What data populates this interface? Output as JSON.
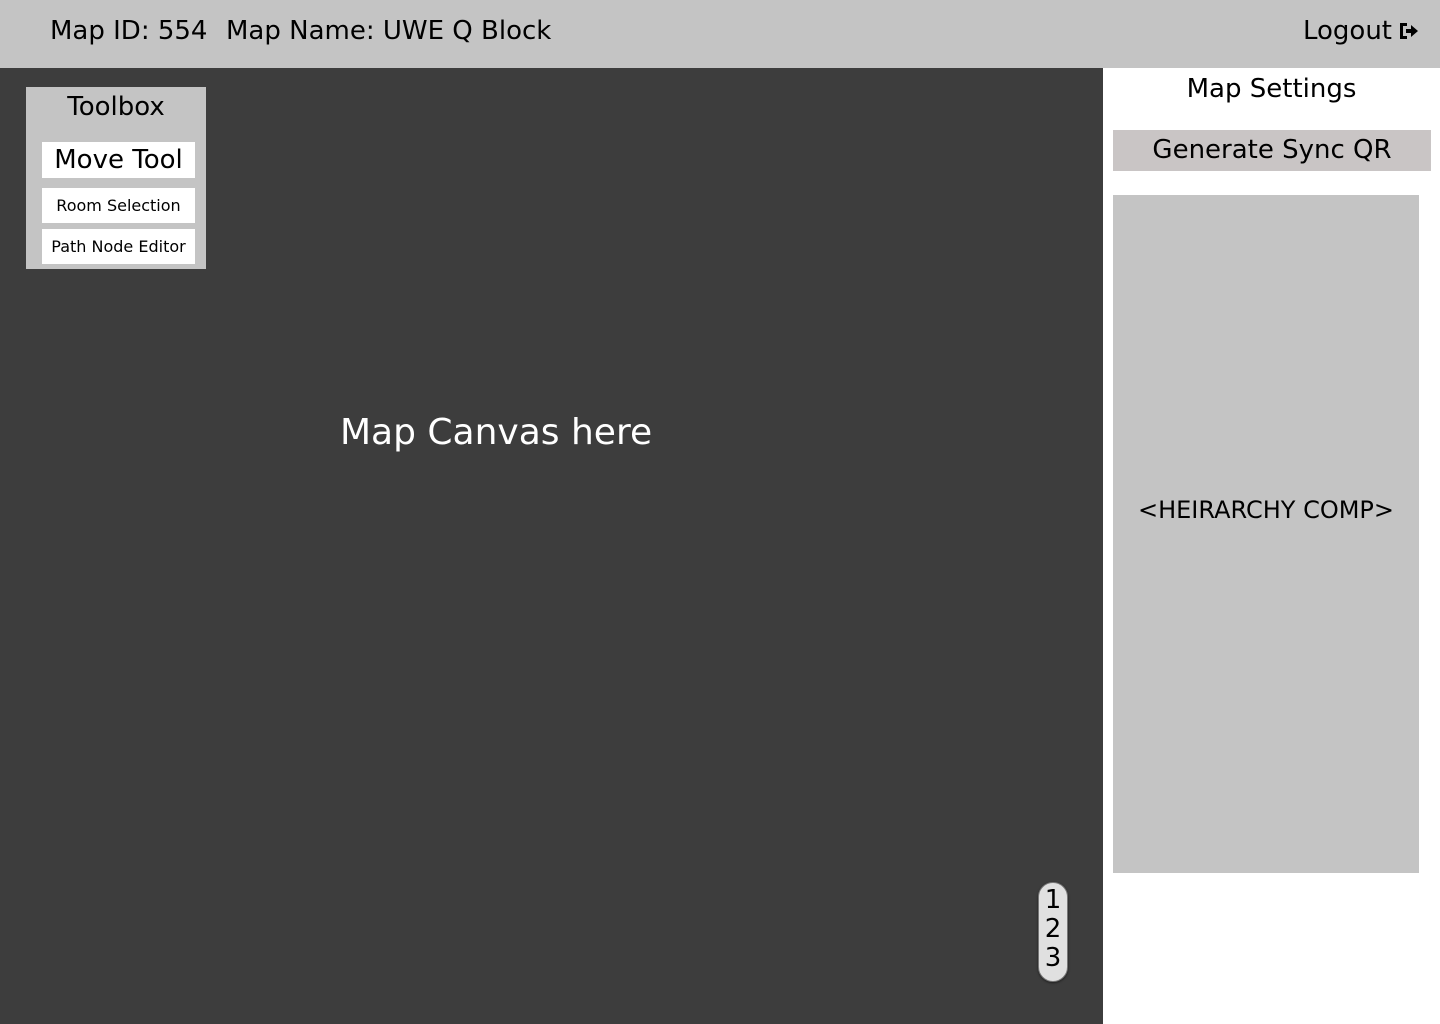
{
  "header": {
    "map_id": "Map ID: 554",
    "map_name": "Map Name: UWE Q Block",
    "logout_label": "Logout",
    "logout_icon": "sign-out-icon"
  },
  "canvas": {
    "label": "Map Canvas here"
  },
  "toolbox": {
    "title": "Toolbox",
    "tools": [
      {
        "label": "Move Tool"
      },
      {
        "label": "Room Selection"
      },
      {
        "label": "Path Node Editor"
      }
    ]
  },
  "floors": [
    "1",
    "2",
    "3"
  ],
  "sidebar": {
    "title": "Map Settings",
    "qr_button": "Generate Sync QR",
    "hierarchy_label": "<HEIRARCHY COMP>"
  },
  "colors": {
    "topbar": "#c4c4c4",
    "canvas": "#3d3d3d",
    "panel": "#c4c4c4",
    "qr_button": "#c9c5c5"
  }
}
